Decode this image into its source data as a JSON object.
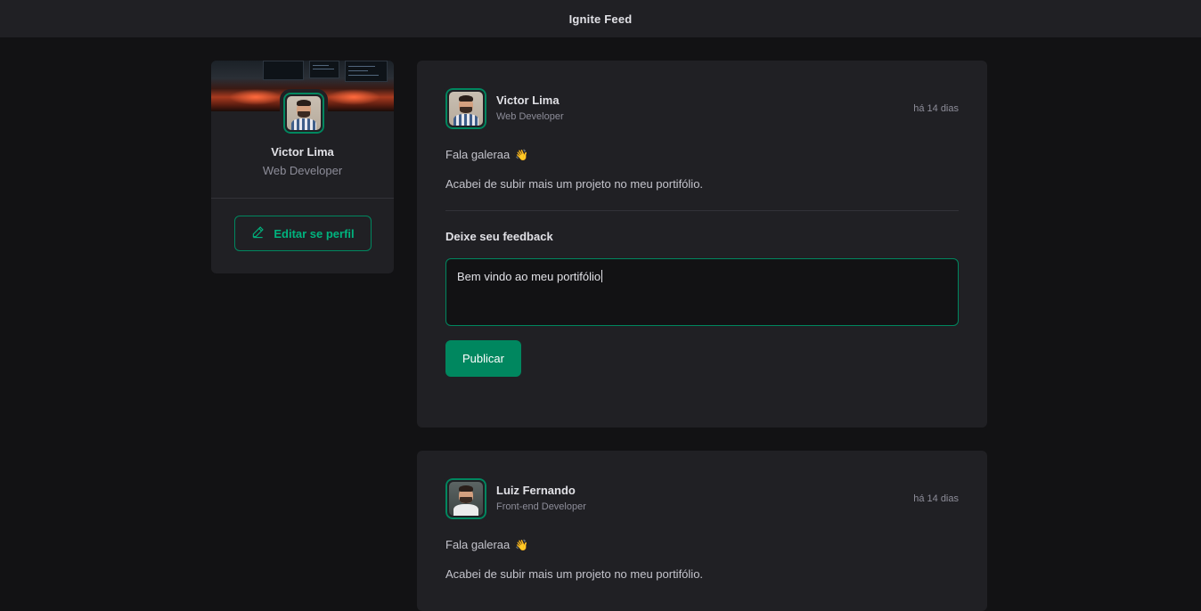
{
  "header": {
    "title": "Ignite Feed"
  },
  "sidebar": {
    "name": "Victor Lima",
    "role": "Web Developer",
    "edit_label": "Editar se perfil",
    "edit_icon": "pencil-icon"
  },
  "posts": [
    {
      "author": "Victor Lima",
      "role": "Web Developer",
      "time": "há 14 dias",
      "lines": [
        "Fala galeraa",
        "Acabei de subir mais um projeto no meu portifólio."
      ],
      "emoji": "👋",
      "feedback_title": "Deixe seu feedback",
      "feedback_value": "Bem vindo ao meu portifólio",
      "publish_label": "Publicar"
    },
    {
      "author": "Luiz Fernando",
      "role": "Front-end Developer",
      "time": "há 14 dias",
      "lines": [
        "Fala galeraa",
        "Acabei de subir mais um projeto no meu portifólio."
      ],
      "emoji": "👋"
    }
  ],
  "colors": {
    "background": "#121214",
    "surface": "#202024",
    "accent": "#00875f",
    "accent_light": "#00b37e",
    "text_primary": "#e1e1e6",
    "text_muted": "#8d8d99"
  }
}
